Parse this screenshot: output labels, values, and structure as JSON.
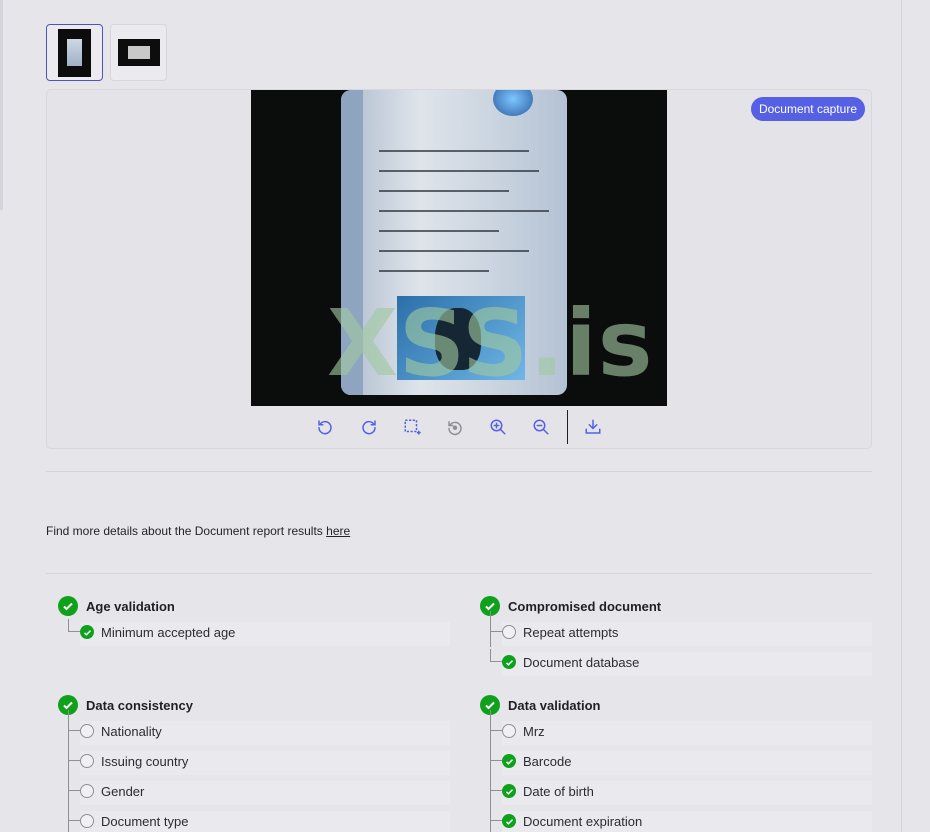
{
  "viewer": {
    "capture_badge": "Document capture",
    "watermark": "XSS.is"
  },
  "toolbar": {
    "tools": [
      "rotate-left-icon",
      "rotate-right-icon",
      "crop-icon",
      "reset-icon",
      "zoom-in-icon",
      "zoom-out-icon",
      "download-icon"
    ]
  },
  "details": {
    "text": "Find more details about the Document report results ",
    "link": "here"
  },
  "results": {
    "age_validation": {
      "title": "Age validation",
      "status": "pass",
      "items": [
        {
          "label": "Minimum accepted age",
          "status": "pass"
        }
      ]
    },
    "compromised_document": {
      "title": "Compromised document",
      "status": "pass",
      "items": [
        {
          "label": "Repeat attempts",
          "status": "empty"
        },
        {
          "label": "Document database",
          "status": "pass"
        }
      ]
    },
    "data_consistency": {
      "title": "Data consistency",
      "status": "pass",
      "items": [
        {
          "label": "Nationality",
          "status": "empty"
        },
        {
          "label": "Issuing country",
          "status": "empty"
        },
        {
          "label": "Gender",
          "status": "empty"
        },
        {
          "label": "Document type",
          "status": "empty"
        }
      ]
    },
    "data_validation": {
      "title": "Data validation",
      "status": "pass",
      "items": [
        {
          "label": "Mrz",
          "status": "empty"
        },
        {
          "label": "Barcode",
          "status": "pass"
        },
        {
          "label": "Date of birth",
          "status": "pass"
        },
        {
          "label": "Document expiration",
          "status": "pass"
        }
      ]
    }
  },
  "colors": {
    "accent": "#5660e4",
    "pass": "#10a11c",
    "active_border": "#4b53c9"
  }
}
